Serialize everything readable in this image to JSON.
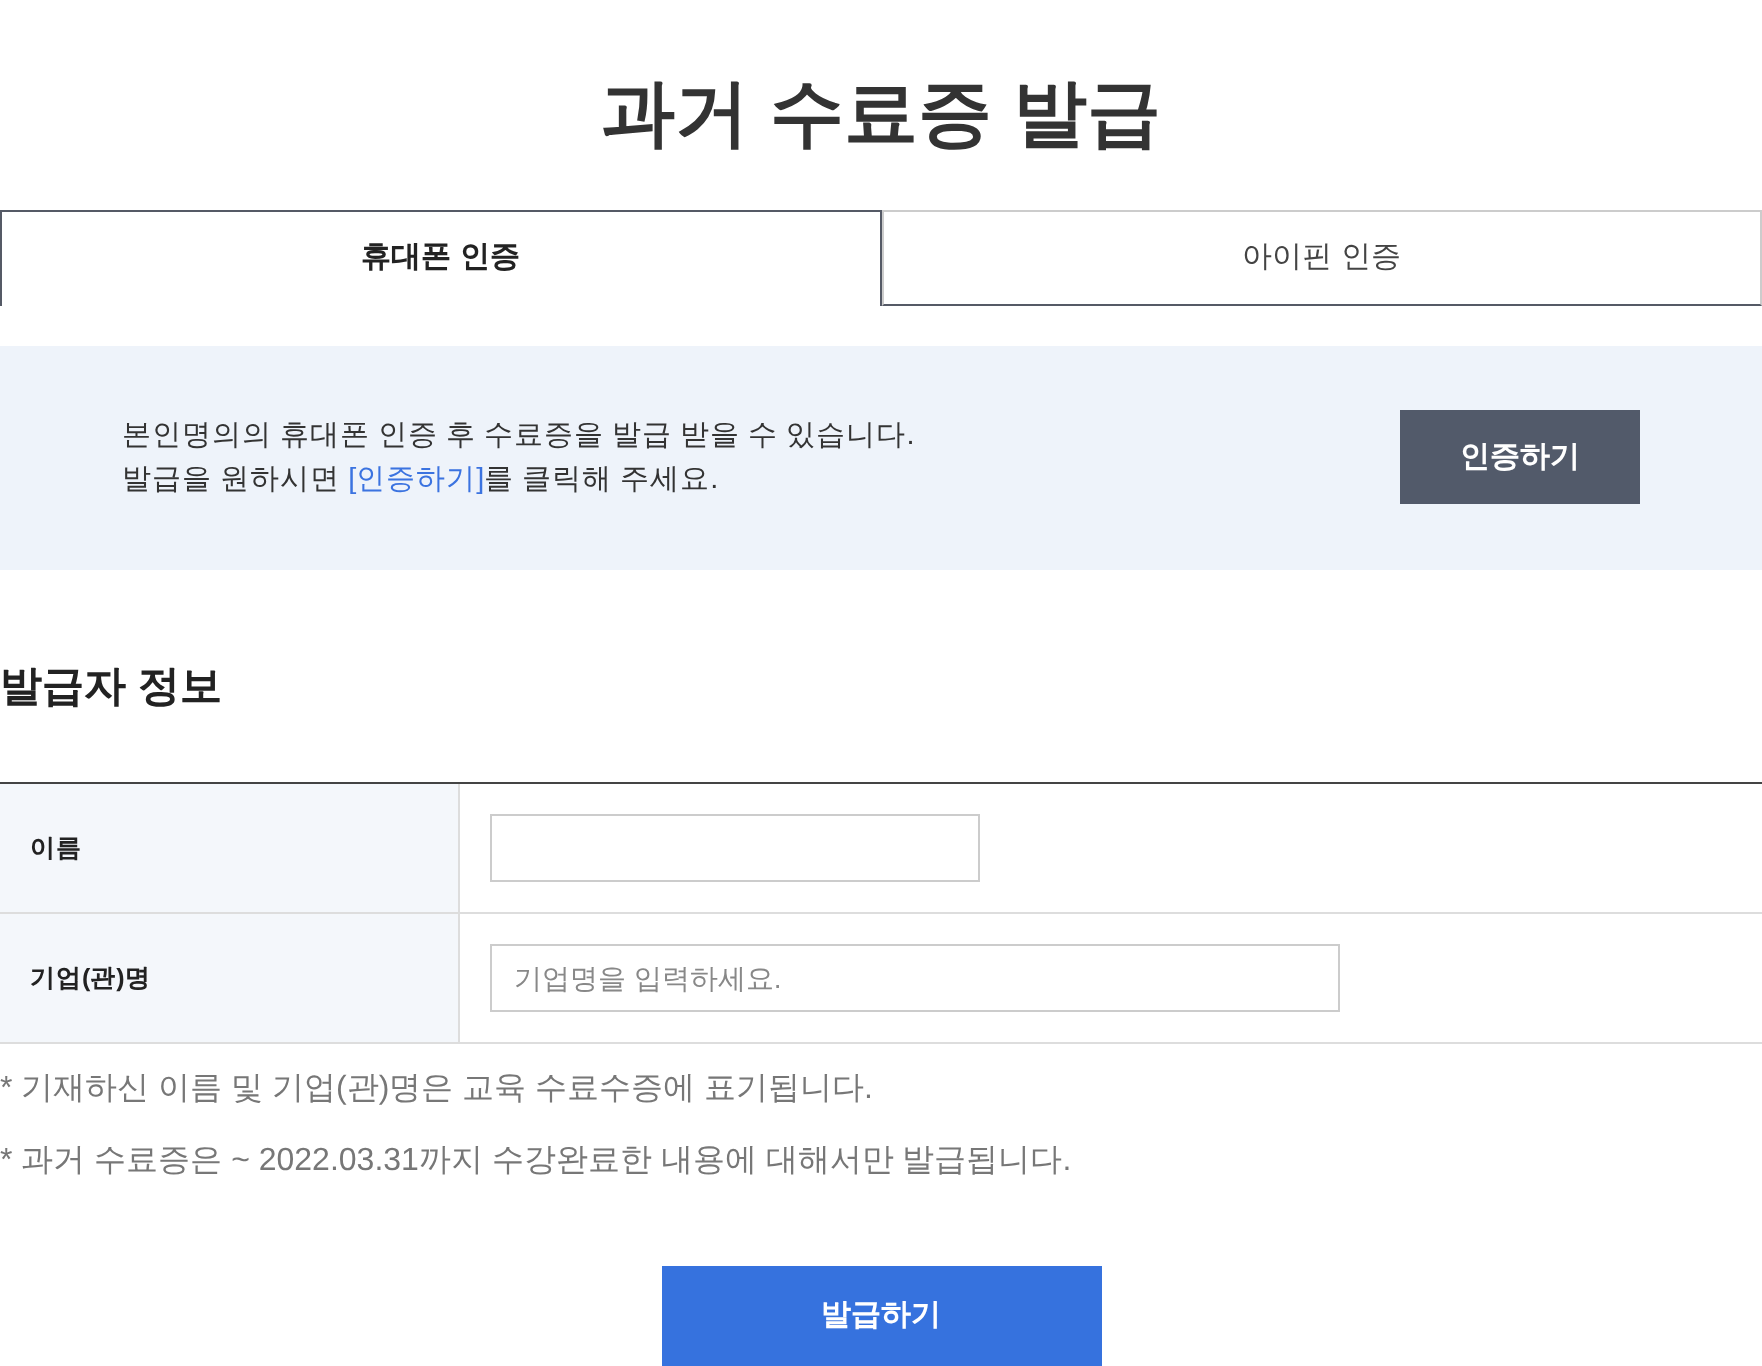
{
  "title": "과거 수료증 발급",
  "tabs": [
    {
      "label": "휴대폰 인증",
      "selected": true
    },
    {
      "label": "아이핀 인증",
      "selected": false
    }
  ],
  "notice": {
    "line_1": "본인명의의 휴대폰 인증 후 수료증을 발급 받을 수 있습니다.",
    "line_2_before": "발급을 원하시면 ",
    "line_2_link": "[인증하기]",
    "line_2_after": "를 클릭해 주세요.",
    "button": "인증하기"
  },
  "section_title": "발급자 정보",
  "form": [
    {
      "label": "이름"
    },
    {
      "label": "기업(관)명",
      "placeholder": "기업명을 입력하세요."
    }
  ],
  "notes": [
    "* 기재하신 이름 및 기업(관)명은 교육 수료수증에 표기됩니다.",
    "* 과거 수료증은 ~ 2022.03.31까지 수강완료한 내용에 대해서만 발급됩니다."
  ],
  "submit": "발급하기"
}
